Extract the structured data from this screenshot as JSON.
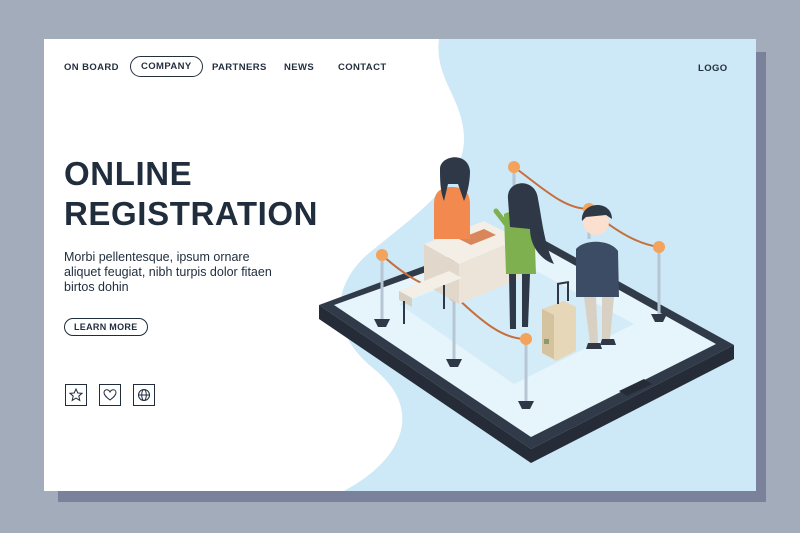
{
  "nav": {
    "items": [
      {
        "label": "ON BOARD",
        "active": false
      },
      {
        "label": "COMPANY",
        "active": true
      },
      {
        "label": "PARTNERS",
        "active": false
      },
      {
        "label": "NEWS",
        "active": false
      },
      {
        "label": "CONTACT",
        "active": false
      }
    ],
    "logo": "LOGO"
  },
  "hero": {
    "title_line1": "ONLINE",
    "title_line2": "REGISTRATION",
    "description": "Morbi pellentesque, ipsum ornare aliquet feugiat, nibh turpis dolor fitaen birtos dohin",
    "cta_label": "LEARN MORE"
  },
  "social": [
    "star-icon",
    "heart-icon",
    "globe-icon"
  ],
  "colors": {
    "background": "#a3acba",
    "card": "#ffffff",
    "accent_blue": "#cde8f6",
    "text": "#1f2d3d",
    "tablet": "#3b4452"
  }
}
